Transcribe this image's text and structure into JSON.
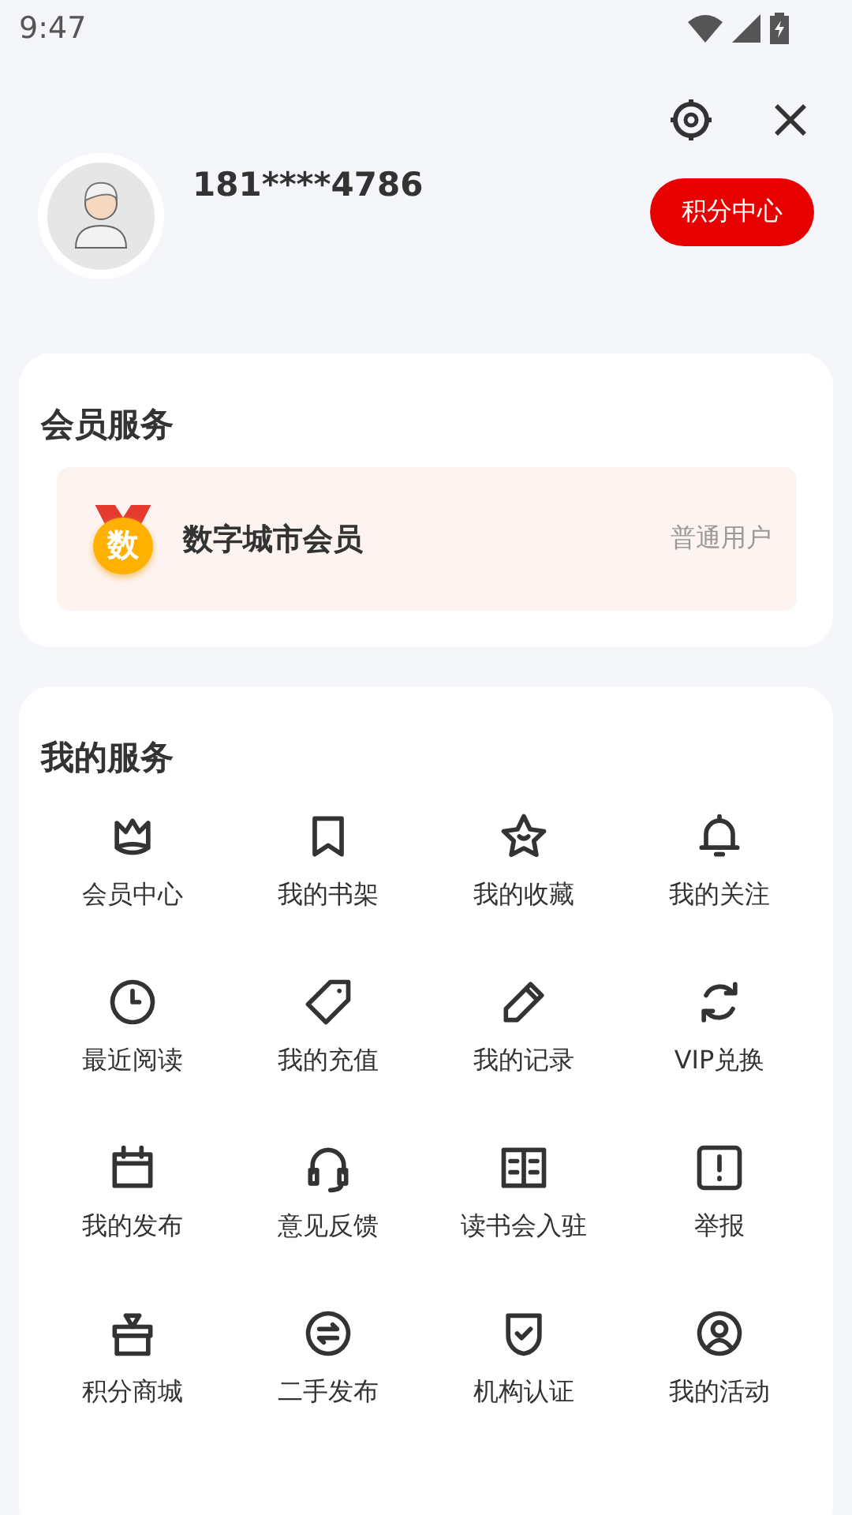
{
  "status_bar": {
    "time": "9:47"
  },
  "profile": {
    "phone": "181****4786",
    "points_button": "积分中心"
  },
  "member_card": {
    "title": "会员服务",
    "badge_text": "数",
    "name": "数字城市会员",
    "level": "普通用户"
  },
  "services": {
    "title": "我的服务",
    "items": [
      {
        "kind": "crown",
        "label": "会员中心"
      },
      {
        "kind": "bookmark",
        "label": "我的书架"
      },
      {
        "kind": "star",
        "label": "我的收藏"
      },
      {
        "kind": "bell",
        "label": "我的关注"
      },
      {
        "kind": "clock",
        "label": "最近阅读"
      },
      {
        "kind": "tag",
        "label": "我的充值"
      },
      {
        "kind": "pencil",
        "label": "我的记录"
      },
      {
        "kind": "refresh",
        "label": "VIP兑换"
      },
      {
        "kind": "calendar",
        "label": "我的发布"
      },
      {
        "kind": "headset",
        "label": "意见反馈"
      },
      {
        "kind": "book",
        "label": "读书会入驻"
      },
      {
        "kind": "alert",
        "label": "举报"
      },
      {
        "kind": "gift",
        "label": "积分商城"
      },
      {
        "kind": "swap",
        "label": "二手发布"
      },
      {
        "kind": "shield",
        "label": "机构认证"
      },
      {
        "kind": "user",
        "label": "我的活动"
      }
    ]
  }
}
